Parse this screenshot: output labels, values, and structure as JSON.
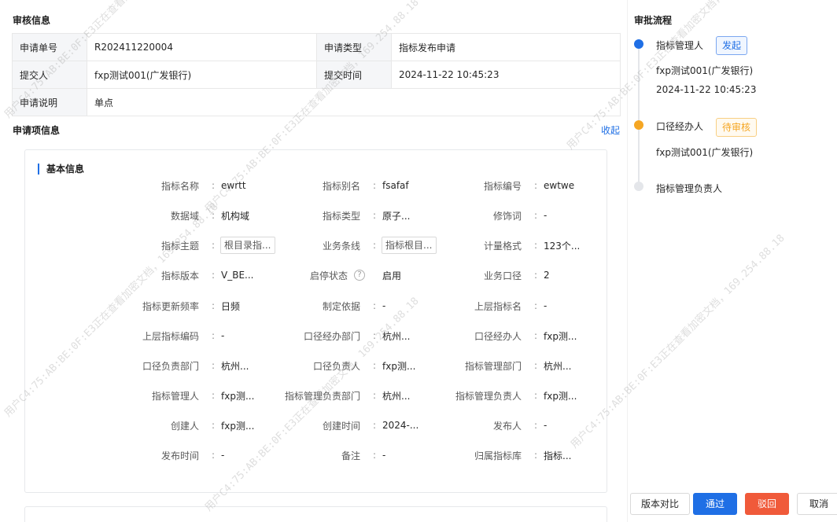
{
  "review": {
    "title": "审核信息",
    "rows": [
      {
        "k1": "申请单号",
        "v1": "R202411220004",
        "k2": "申请类型",
        "v2": "指标发布申请"
      },
      {
        "k1": "提交人",
        "v1": "fxp测试001(广发银行)",
        "k2": "提交时间",
        "v2": "2024-11-22 10:45:23"
      },
      {
        "k1": "申请说明",
        "v1": "单点",
        "k2": "",
        "v2": ""
      }
    ]
  },
  "apply": {
    "title": "申请项信息",
    "collapse_label": "收起",
    "basic_title": "基本信息",
    "rows": [
      [
        {
          "k": "指标名称",
          "v": "ewrtt"
        },
        {
          "k": "指标别名",
          "v": "fsafaf"
        },
        {
          "k": "指标编号",
          "v": "ewtwe"
        }
      ],
      [
        {
          "k": "数据域",
          "v": "机构域"
        },
        {
          "k": "指标类型",
          "v": "原子..."
        },
        {
          "k": "修饰词",
          "v": "-"
        }
      ],
      [
        {
          "k": "指标主题",
          "v": "根目录指..."
        },
        {
          "k": "业务条线",
          "v": "指标根目..."
        },
        {
          "k": "计量格式",
          "v": "123个..."
        }
      ],
      [
        {
          "k": "指标版本",
          "v": "V_BE..."
        },
        {
          "k": "启停状态",
          "v": "启用"
        },
        {
          "k": "业务口径",
          "v": "2"
        }
      ],
      [
        {
          "k": "指标更新频率",
          "v": "日频"
        },
        {
          "k": "制定依据",
          "v": "-"
        },
        {
          "k": "上层指标名",
          "v": "-"
        }
      ],
      [
        {
          "k": "上层指标编码",
          "v": "-"
        },
        {
          "k": "口径经办部门",
          "v": "杭州..."
        },
        {
          "k": "口径经办人",
          "v": "fxp测..."
        }
      ],
      [
        {
          "k": "口径负责部门",
          "v": "杭州..."
        },
        {
          "k": "口径负责人",
          "v": "fxp测..."
        },
        {
          "k": "指标管理部门",
          "v": "杭州..."
        }
      ],
      [
        {
          "k": "指标管理人",
          "v": "fxp测..."
        },
        {
          "k": "指标管理负责部门",
          "v": "杭州..."
        },
        {
          "k": "指标管理负责人",
          "v": "fxp测..."
        }
      ],
      [
        {
          "k": "创建人",
          "v": "fxp测..."
        },
        {
          "k": "创建时间",
          "v": "2024-..."
        },
        {
          "k": "发布人",
          "v": "-"
        }
      ],
      [
        {
          "k": "发布时间",
          "v": "-"
        },
        {
          "k": "备注",
          "v": "-"
        },
        {
          "k": "归属指标库",
          "v": "指标..."
        }
      ]
    ]
  },
  "flow": {
    "title": "审批流程",
    "steps": [
      {
        "name": "指标管理人",
        "tag": "发起",
        "sub1": "fxp测试001(广发银行)",
        "sub2": "2024-11-22 10:45:23",
        "color": "#1f6fe5"
      },
      {
        "name": "口径经办人",
        "tag": "待审核",
        "sub1": "fxp测试001(广发银行)",
        "sub2": "",
        "color": "#f5a623"
      },
      {
        "name": "指标管理负责人",
        "tag": "",
        "sub1": "",
        "sub2": "",
        "color": "#e4e6ea"
      }
    ]
  },
  "actions": {
    "compare": "版本对比",
    "approve": "通过",
    "reject": "驳回",
    "cancel": "取消"
  },
  "watermark": "用户C4:75:AB:BE:0F:E3正在查看加密文档，169.254.88.18"
}
